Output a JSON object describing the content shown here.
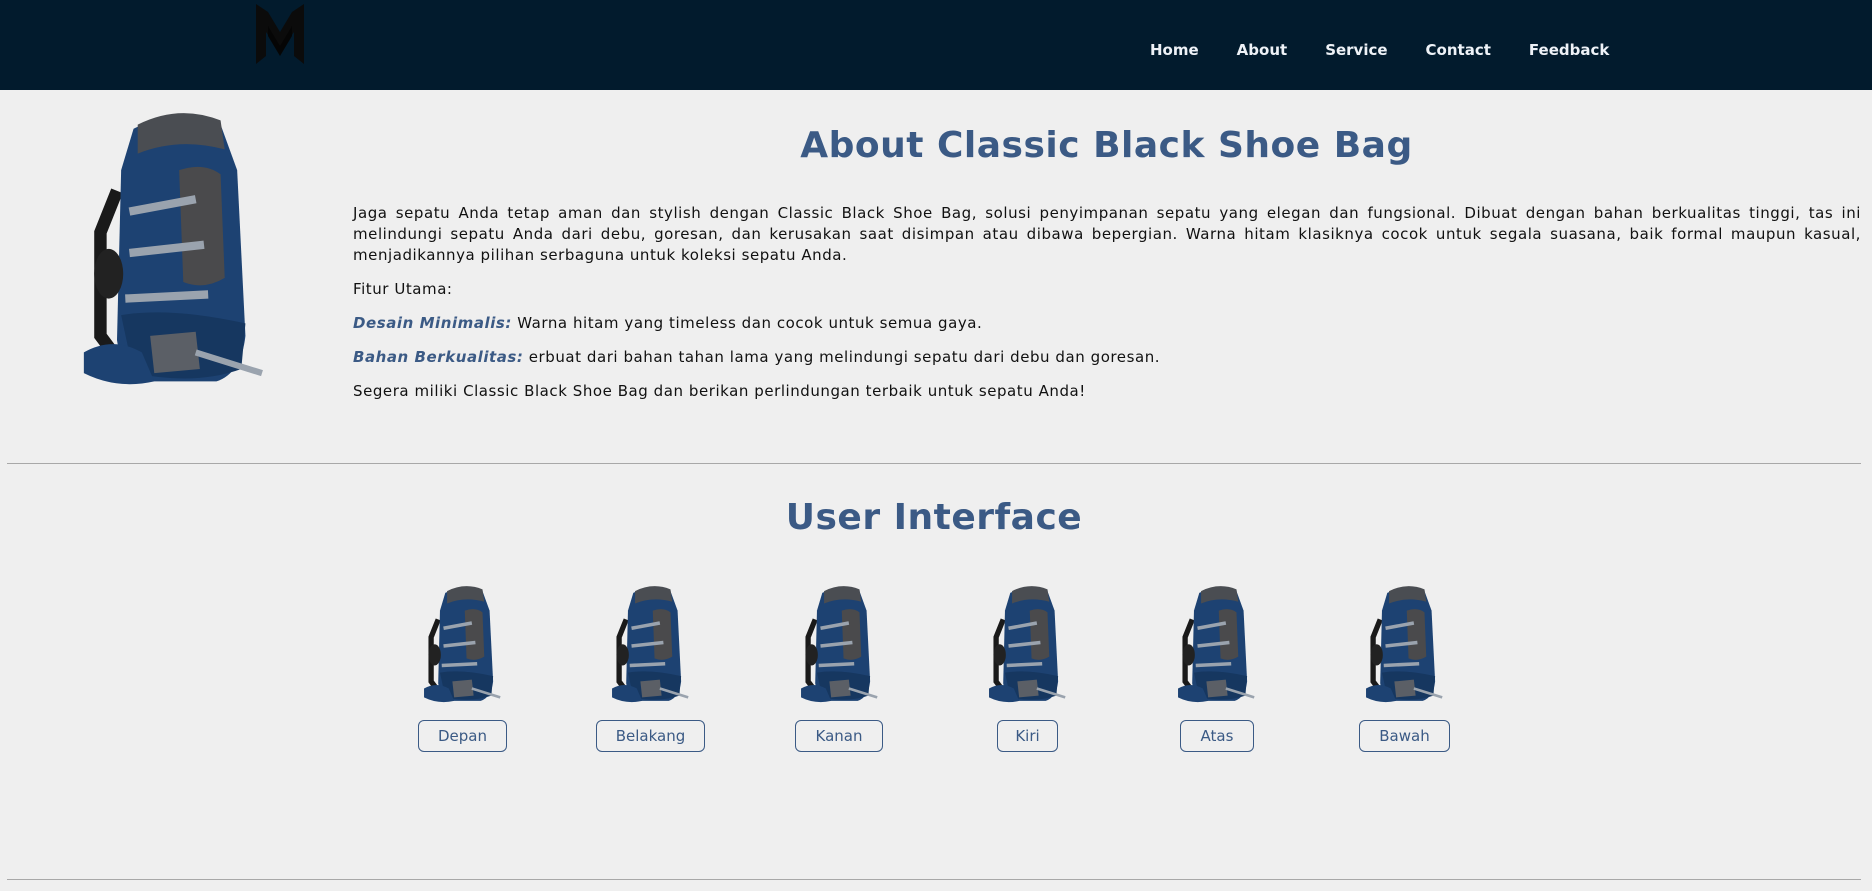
{
  "nav": {
    "logo": "M",
    "links": [
      "Home",
      "About",
      "Service",
      "Contact",
      "Feedback"
    ]
  },
  "about": {
    "title": "About Classic Black Shoe Bag",
    "intro": "Jaga sepatu Anda tetap aman dan stylish dengan Classic Black Shoe Bag, solusi penyimpanan sepatu yang elegan dan fungsional. Dibuat dengan bahan berkualitas tinggi, tas ini melindungi sepatu Anda dari debu, goresan, dan kerusakan saat disimpan atau dibawa bepergian. Warna hitam klasiknya cocok untuk segala suasana, baik formal maupun kasual, menjadikannya pilihan serbaguna untuk koleksi sepatu Anda.",
    "features_label": "Fitur Utama:",
    "features": [
      {
        "name": "Desain Minimalis:",
        "text": " Warna hitam yang timeless dan cocok untuk semua gaya."
      },
      {
        "name": "Bahan Berkualitas:",
        "text": " erbuat dari bahan tahan lama yang melindungi sepatu dari debu dan goresan."
      }
    ],
    "closing": "Segera miliki Classic Black Shoe Bag dan berikan perlindungan terbaik untuk sepatu Anda!"
  },
  "ui": {
    "title": "User Interface",
    "views": [
      "Depan",
      "Belakang",
      "Kanan",
      "Kiri",
      "Atas",
      "Bawah"
    ]
  },
  "colors": {
    "navbar": "#021b2d",
    "accent": "#3b5a85",
    "background": "#efefef"
  }
}
